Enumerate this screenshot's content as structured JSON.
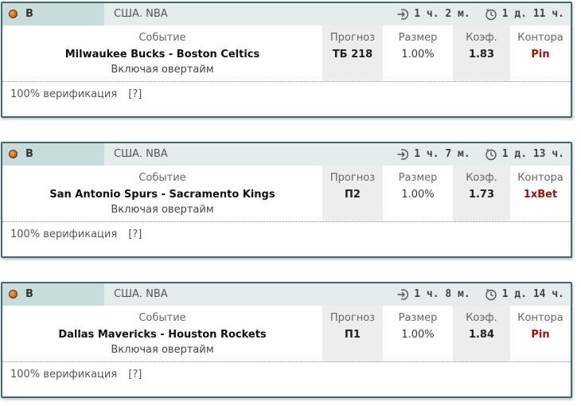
{
  "cards": [
    {
      "sport_letter": "В",
      "league": "США. NBA",
      "time_start": "1 ч. 2 м.",
      "time_end": "1 д. 11 ч.",
      "event_label": "Событие",
      "event": "Milwaukee Bucks - Boston Celtics",
      "event_note": "Включая овертайм",
      "prog_label": "Прогноз",
      "prog": "ТБ 218",
      "size_label": "Размер",
      "size": "1.00%",
      "coef_label": "Коэф.",
      "coef": "1.83",
      "book_label": "Контора",
      "book": "Pin",
      "verify": "100% верификация",
      "help": "[?]"
    },
    {
      "sport_letter": "В",
      "league": "США. NBA",
      "time_start": "1 ч. 7 м.",
      "time_end": "1 д. 13 ч.",
      "event_label": "Событие",
      "event": "San Antonio Spurs - Sacramento Kings",
      "event_note": "Включая овертайм",
      "prog_label": "Прогноз",
      "prog": "П2",
      "size_label": "Размер",
      "size": "1.00%",
      "coef_label": "Коэф.",
      "coef": "1.73",
      "book_label": "Контора",
      "book": "1xBet",
      "verify": "100% верификация",
      "help": "[?]"
    },
    {
      "sport_letter": "В",
      "league": "США. NBA",
      "time_start": "1 ч. 8 м.",
      "time_end": "1 д. 14 ч.",
      "event_label": "Событие",
      "event": "Dallas Mavericks - Houston Rockets",
      "event_note": "Включая овертайм",
      "prog_label": "Прогноз",
      "prog": "П1",
      "size_label": "Размер",
      "size": "1.00%",
      "coef_label": "Коэф.",
      "coef": "1.84",
      "book_label": "Контора",
      "book": "Pin",
      "verify": "100% верификация",
      "help": "[?]"
    }
  ],
  "icons": {
    "sport": "basketball-icon",
    "start": "arrow-in-icon",
    "end": "timer-icon"
  },
  "colors": {
    "header_bg": "#e5ecec",
    "sport_bg": "#c8dcdc",
    "border": "#3f6b6e",
    "bookmaker": "#9a1010"
  }
}
